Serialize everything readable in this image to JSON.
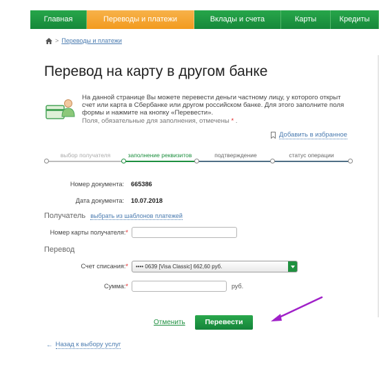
{
  "nav": {
    "items": [
      {
        "label": "Главная",
        "active": false
      },
      {
        "label": "Переводы и платежи",
        "active": true
      },
      {
        "label": "Вклады и счета",
        "active": false
      },
      {
        "label": "Карты",
        "active": false
      },
      {
        "label": "Кредиты",
        "active": false
      }
    ]
  },
  "breadcrumb": {
    "sep": ">",
    "link": "Переводы и платежи"
  },
  "page": {
    "title": "Перевод на карту в другом банке"
  },
  "info": {
    "text": "На данной странице Вы можете перевести деньги частному лицу, у которого открыт счет или карта в Сбербанке или другом российском банке. Для этого заполните поля формы и нажмите на кнопку «Перевести».",
    "required_note": "Поля, обязательные для заполнения, отмечены",
    "star": "*",
    "dot": "."
  },
  "favorites": {
    "label": "Добавить в избранное"
  },
  "steps": [
    {
      "label": "выбор получателя",
      "state": "done"
    },
    {
      "label": "заполнение реквизитов",
      "state": "current"
    },
    {
      "label": "подтверждение",
      "state": "todo"
    },
    {
      "label": "статус операции",
      "state": "todo"
    }
  ],
  "document": {
    "number_label": "Номер документа:",
    "number_value": "665386",
    "date_label": "Дата документа:",
    "date_value": "10.07.2018"
  },
  "recipient": {
    "section_label": "Получатель",
    "template_link": "выбрать из шаблонов платежей",
    "card_label": "Номер карты получателя:",
    "card_value": "",
    "star": "*"
  },
  "transfer": {
    "section_label": "Перевод",
    "account_label": "Счет списания:",
    "account_value": "•••• 0639  [Visa Classic] 662,60  руб.",
    "amount_label": "Сумма:",
    "amount_value": "",
    "currency": "руб.",
    "star": "*"
  },
  "actions": {
    "cancel": "Отменить",
    "submit": "Перевести"
  },
  "back": {
    "arrow": "←",
    "label": "Назад к выбору услуг"
  },
  "colors": {
    "green": "#1d8f3f",
    "orange": "#f29a1e",
    "annotation": "#a020c8",
    "link": "#4a7bb0"
  }
}
